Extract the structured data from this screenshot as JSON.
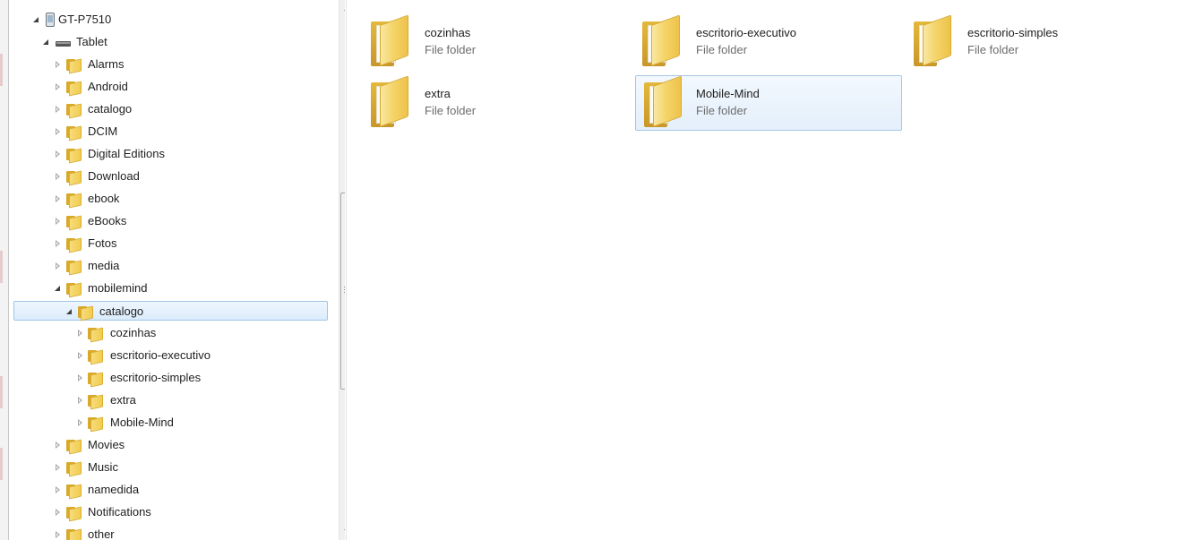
{
  "tree": {
    "device": "GT-P7510",
    "storage": "Tablet",
    "folders_before": [
      "Alarms",
      "Android",
      "catalogo",
      "DCIM",
      "Digital Editions",
      "Download",
      "ebook",
      "eBooks",
      "Fotos",
      "media"
    ],
    "expanded_folder": "mobilemind",
    "selected_folder": "catalogo",
    "children": [
      "cozinhas",
      "escritorio-executivo",
      "escritorio-simples",
      "extra",
      "Mobile-Mind"
    ],
    "folders_after": [
      "Movies",
      "Music",
      "namedida",
      "Notifications",
      "other"
    ]
  },
  "content": {
    "items": [
      {
        "name": "cozinhas",
        "type": "File folder",
        "selected": false
      },
      {
        "name": "escritorio-executivo",
        "type": "File folder",
        "selected": false
      },
      {
        "name": "escritorio-simples",
        "type": "File folder",
        "selected": false
      },
      {
        "name": "extra",
        "type": "File folder",
        "selected": false
      },
      {
        "name": "Mobile-Mind",
        "type": "File folder",
        "selected": true
      }
    ]
  },
  "colors": {
    "selection_fill": "#dcecfc",
    "selection_border": "#9ec4e8",
    "folder_yellow": "#f4d56a",
    "secondary_text": "#6d6d6d"
  },
  "icons": [
    "phone-icon",
    "tablet-icon",
    "folder-icon",
    "expand-arrow-icon",
    "collapse-arrow-icon"
  ]
}
